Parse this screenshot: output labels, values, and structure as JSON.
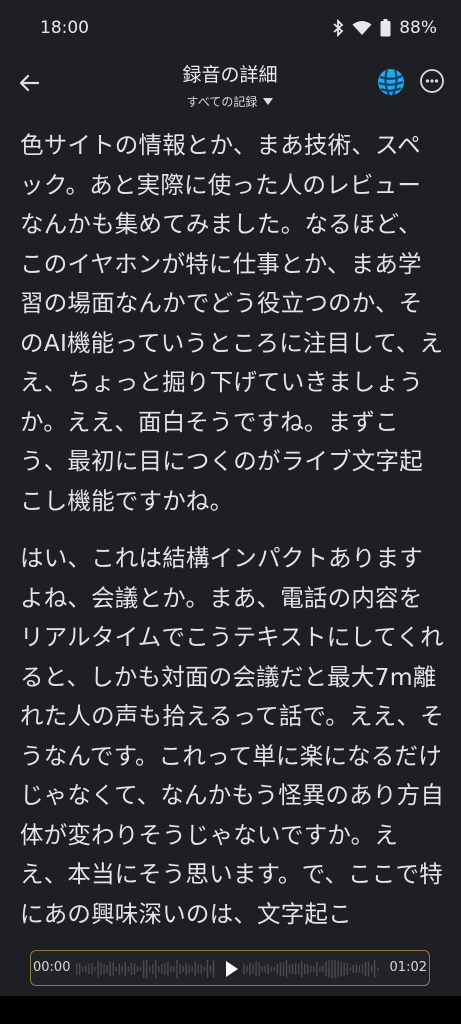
{
  "status_bar": {
    "time": "18:00",
    "battery_percent": "88%",
    "icons": [
      "bluetooth-icon",
      "wifi-icon",
      "battery-icon"
    ]
  },
  "header": {
    "title": "録音の詳細",
    "subtitle": "すべての記録",
    "icons": [
      "back-arrow-icon",
      "caret-down-icon",
      "avatar-globe-icon",
      "more-options-icon"
    ]
  },
  "transcript": {
    "paragraphs": [
      "色サイトの情報とか、まあ技術、スペック。あと実際に使った人のレビューなんかも集めてみました。なるほど、このイヤホンが特に仕事とか、まあ学習の場面なんかでどう役立つのか、そのAI機能っていうところに注目して、ええ、ちょっと掘り下げていきましょうか。ええ、面白そうですね。まずこう、最初に目につくのがライブ文字起こし機能ですかね。",
      "はい、これは結構インパクトありますよね、会議とか。まあ、電話の内容をリアルタイムでこうテキストにしてくれると、しかも対面の会議だと最大7m離れた人の声も拾えるって話で。ええ、そうなんです。これって単に楽になるだけじゃなくて、なんかもう怪異のあり方自体が変わりそうじゃないですか。ええ、本当にそう思います。で、ここで特にあの興味深いのは、文字起こ"
    ]
  },
  "player": {
    "current_time": "00:00",
    "duration": "01:02",
    "progress": 0,
    "accent_color": "#8d7a3e"
  },
  "colors": {
    "background": "#1e1f24",
    "text": "#e4e4e4"
  }
}
